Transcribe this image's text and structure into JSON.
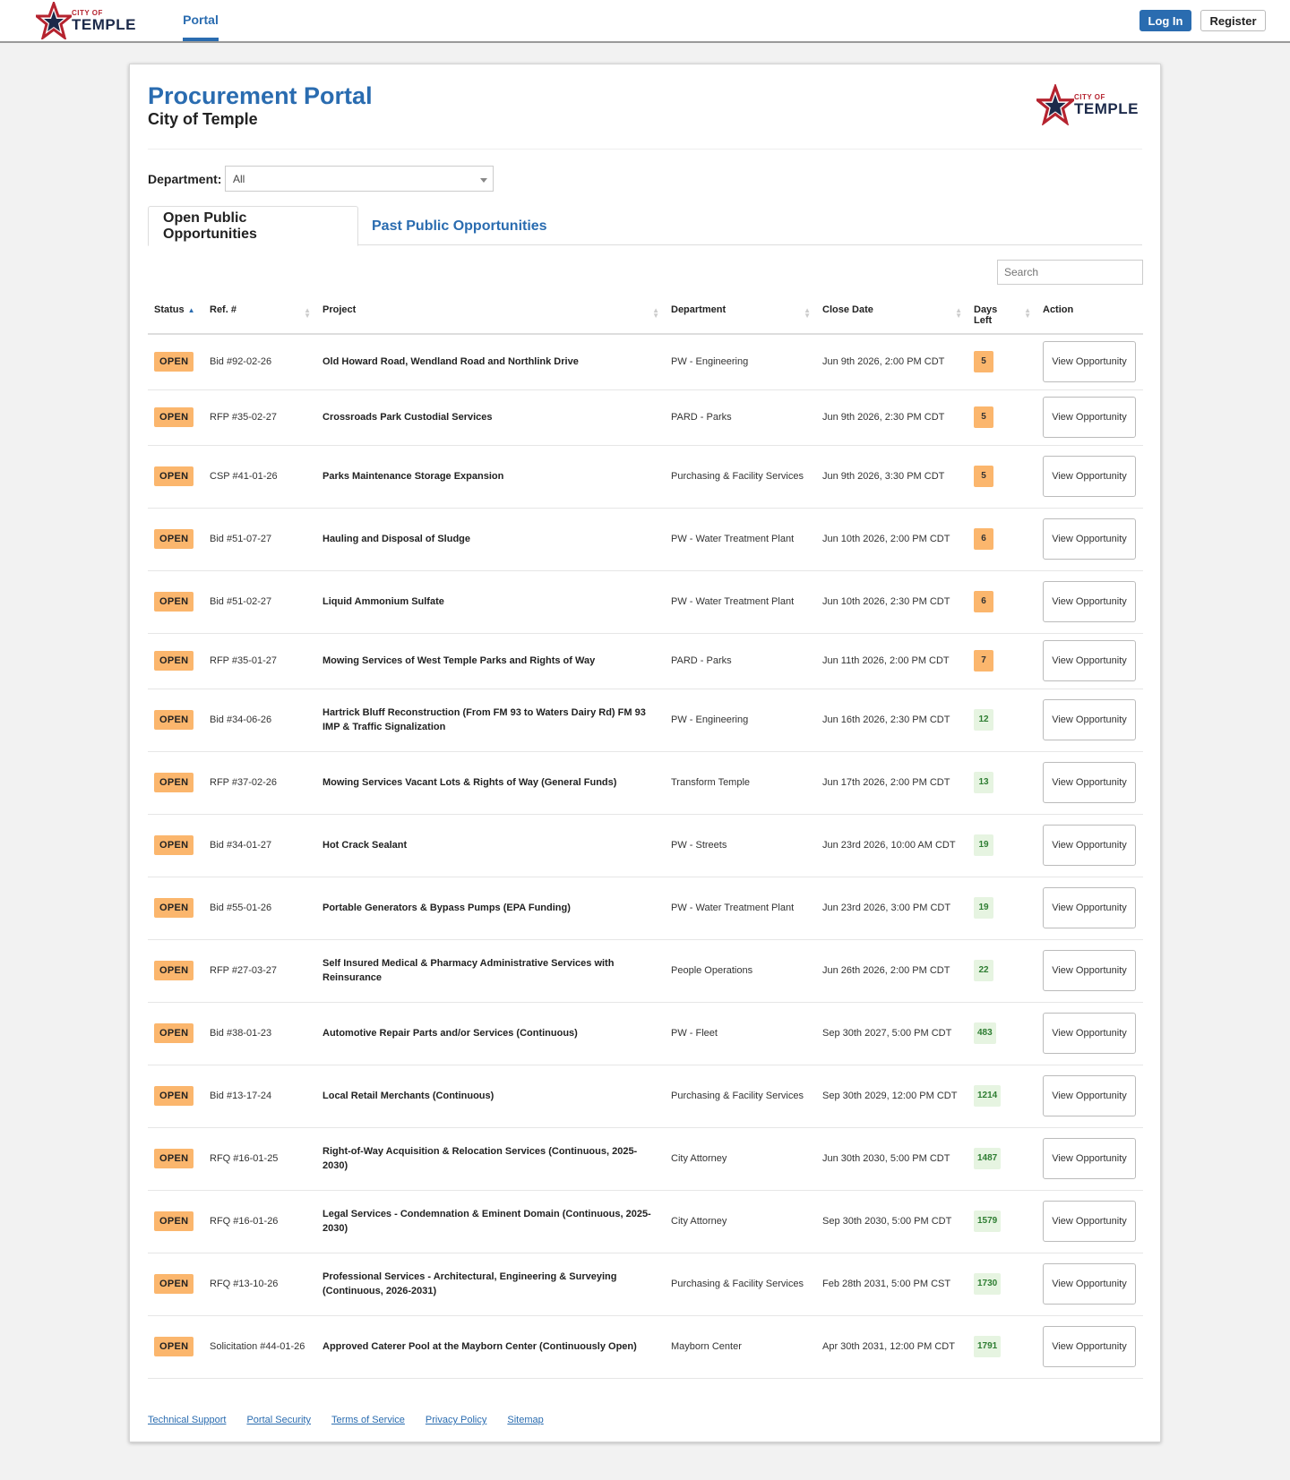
{
  "topbar": {
    "logo": {
      "cityof": "CITY OF",
      "name": "TEMPLE"
    },
    "nav_tab": "Portal",
    "login_label": "Log In",
    "register_label": "Register"
  },
  "header": {
    "title": "Procurement Portal",
    "subtitle": "City of Temple",
    "logo": {
      "cityof": "CITY OF",
      "name": "TEMPLE"
    }
  },
  "filters": {
    "department_label": "Department:",
    "department_value": "All",
    "search_placeholder": "Search"
  },
  "tabs": [
    {
      "label": "Open Public Opportunities",
      "active": true
    },
    {
      "label": "Past Public Opportunities",
      "active": false
    }
  ],
  "table": {
    "columns": [
      "Status",
      "Ref. #",
      "Project",
      "Department",
      "Close Date",
      "Days Left",
      "Action"
    ],
    "action_label": "View Opportunity",
    "rows": [
      {
        "status": "OPEN",
        "ref": "Bid #92-02-26",
        "project": "Old Howard Road, Wendland Road and Northlink Drive",
        "department": "PW - Engineering",
        "close": "Jun 9th 2026, 2:00 PM CDT",
        "days": "5"
      },
      {
        "status": "OPEN",
        "ref": "RFP #35-02-27",
        "project": "Crossroads Park Custodial Services",
        "department": "PARD - Parks",
        "close": "Jun 9th 2026, 2:30 PM CDT",
        "days": "5"
      },
      {
        "status": "OPEN",
        "ref": "CSP #41-01-26",
        "project": "Parks Maintenance Storage Expansion",
        "department": "Purchasing & Facility Services",
        "close": "Jun 9th 2026, 3:30 PM CDT",
        "days": "5"
      },
      {
        "status": "OPEN",
        "ref": "Bid #51-07-27",
        "project": "Hauling and Disposal of Sludge",
        "department": "PW - Water Treatment Plant",
        "close": "Jun 10th 2026, 2:00 PM CDT",
        "days": "6"
      },
      {
        "status": "OPEN",
        "ref": "Bid #51-02-27",
        "project": "Liquid Ammonium Sulfate",
        "department": "PW - Water Treatment Plant",
        "close": "Jun 10th 2026, 2:30 PM CDT",
        "days": "6"
      },
      {
        "status": "OPEN",
        "ref": "RFP #35-01-27",
        "project": "Mowing Services of West Temple Parks and Rights of Way",
        "department": "PARD - Parks",
        "close": "Jun 11th 2026, 2:00 PM CDT",
        "days": "7"
      },
      {
        "status": "OPEN",
        "ref": "Bid #34-06-26",
        "project": "Hartrick Bluff Reconstruction (From FM 93 to Waters Dairy Rd) FM 93 IMP & Traffic Signalization",
        "department": "PW - Engineering",
        "close": "Jun 16th 2026, 2:30 PM CDT",
        "days": "12"
      },
      {
        "status": "OPEN",
        "ref": "RFP #37-02-26",
        "project": "Mowing Services Vacant Lots & Rights of Way (General Funds)",
        "department": "Transform Temple",
        "close": "Jun 17th 2026, 2:00 PM CDT",
        "days": "13"
      },
      {
        "status": "OPEN",
        "ref": "Bid #34-01-27",
        "project": "Hot Crack Sealant",
        "department": "PW - Streets",
        "close": "Jun 23rd 2026, 10:00 AM CDT",
        "days": "19"
      },
      {
        "status": "OPEN",
        "ref": "Bid #55-01-26",
        "project": "Portable Generators & Bypass Pumps (EPA Funding)",
        "department": "PW - Water Treatment Plant",
        "close": "Jun 23rd 2026, 3:00 PM CDT",
        "days": "19"
      },
      {
        "status": "OPEN",
        "ref": "RFP #27-03-27",
        "project": "Self Insured Medical & Pharmacy Administrative Services with Reinsurance",
        "department": "People Operations",
        "close": "Jun 26th 2026, 2:00 PM CDT",
        "days": "22"
      },
      {
        "status": "OPEN",
        "ref": "Bid #38-01-23",
        "project": "Automotive Repair Parts and/or Services (Continuous)",
        "department": "PW - Fleet",
        "close": "Sep 30th 2027, 5:00 PM CDT",
        "days": "483"
      },
      {
        "status": "OPEN",
        "ref": "Bid #13-17-24",
        "project": "Local Retail Merchants (Continuous)",
        "department": "Purchasing & Facility Services",
        "close": "Sep 30th 2029, 12:00 PM CDT",
        "days": "1214"
      },
      {
        "status": "OPEN",
        "ref": "RFQ #16-01-25",
        "project": "Right-of-Way Acquisition & Relocation Services (Continuous, 2025-2030)",
        "department": "City Attorney",
        "close": "Jun 30th 2030, 5:00 PM CDT",
        "days": "1487"
      },
      {
        "status": "OPEN",
        "ref": "RFQ #16-01-26",
        "project": "Legal Services - Condemnation & Eminent Domain (Continuous, 2025-2030)",
        "department": "City Attorney",
        "close": "Sep 30th 2030, 5:00 PM CDT",
        "days": "1579"
      },
      {
        "status": "OPEN",
        "ref": "RFQ #13-10-26",
        "project": "Professional Services - Architectural, Engineering & Surveying (Continuous, 2026-2031)",
        "department": "Purchasing & Facility Services",
        "close": "Feb 28th 2031, 5:00 PM CST",
        "days": "1730"
      },
      {
        "status": "OPEN",
        "ref": "Solicitation #44-01-26",
        "project": "Approved Caterer Pool at the Mayborn Center (Continuously Open)",
        "department": "Mayborn Center",
        "close": "Apr 30th 2031, 12:00 PM CDT",
        "days": "1791"
      }
    ]
  },
  "footer": {
    "links": [
      "Technical Support",
      "Portal Security",
      "Terms of Service",
      "Privacy Policy",
      "Sitemap"
    ]
  },
  "colors": {
    "brand_blue": "#2a6cb0",
    "status_orange": "#fbb66d",
    "days_green_bg": "#e6f4e1",
    "days_green_text": "#2e7d32"
  }
}
